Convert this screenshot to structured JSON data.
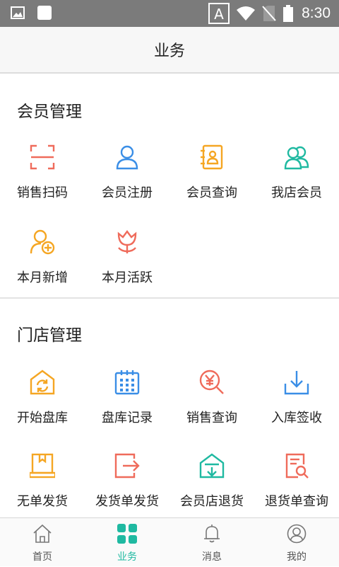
{
  "status_bar": {
    "time": "8:30",
    "icons": [
      "image-icon",
      "square-app-icon",
      "keyboard-a-icon",
      "wifi-icon",
      "no-sim-icon",
      "battery-icon"
    ]
  },
  "header": {
    "title": "业务"
  },
  "member_section": {
    "title": "会员管理",
    "items": [
      {
        "label": "销售扫码",
        "icon": "scan-icon",
        "color": "#ef6b5b"
      },
      {
        "label": "会员注册",
        "icon": "user-icon",
        "color": "#3a8ee6"
      },
      {
        "label": "会员查询",
        "icon": "contact-book-icon",
        "color": "#f5a623"
      },
      {
        "label": "我店会员",
        "icon": "users-icon",
        "color": "#1fb9a1"
      },
      {
        "label": "本月新增",
        "icon": "user-add-icon",
        "color": "#f5a623"
      },
      {
        "label": "本月活跃",
        "icon": "flower-icon",
        "color": "#ef6b5b"
      }
    ]
  },
  "store_section": {
    "title": "门店管理",
    "items": [
      {
        "label": "开始盘库",
        "icon": "warehouse-refresh-icon",
        "color": "#f5a623"
      },
      {
        "label": "盘库记录",
        "icon": "calendar-icon",
        "color": "#3a8ee6"
      },
      {
        "label": "销售查询",
        "icon": "yen-search-icon",
        "color": "#ef6b5b"
      },
      {
        "label": "入库签收",
        "icon": "download-tray-icon",
        "color": "#3a8ee6"
      },
      {
        "label": "无单发货",
        "icon": "package-icon",
        "color": "#f5a623"
      },
      {
        "label": "发货单发货",
        "icon": "export-icon",
        "color": "#ef6b5b"
      },
      {
        "label": "会员店退货",
        "icon": "store-return-icon",
        "color": "#1fb9a1"
      },
      {
        "label": "退货单查询",
        "icon": "document-search-icon",
        "color": "#ef6b5b"
      }
    ]
  },
  "tab_bar": {
    "active_color": "#1fb9a1",
    "tabs": [
      {
        "label": "首页",
        "icon": "home-icon",
        "active": false
      },
      {
        "label": "业务",
        "icon": "grid-icon",
        "active": true
      },
      {
        "label": "消息",
        "icon": "bell-icon",
        "active": false
      },
      {
        "label": "我的",
        "icon": "profile-icon",
        "active": false
      }
    ]
  }
}
